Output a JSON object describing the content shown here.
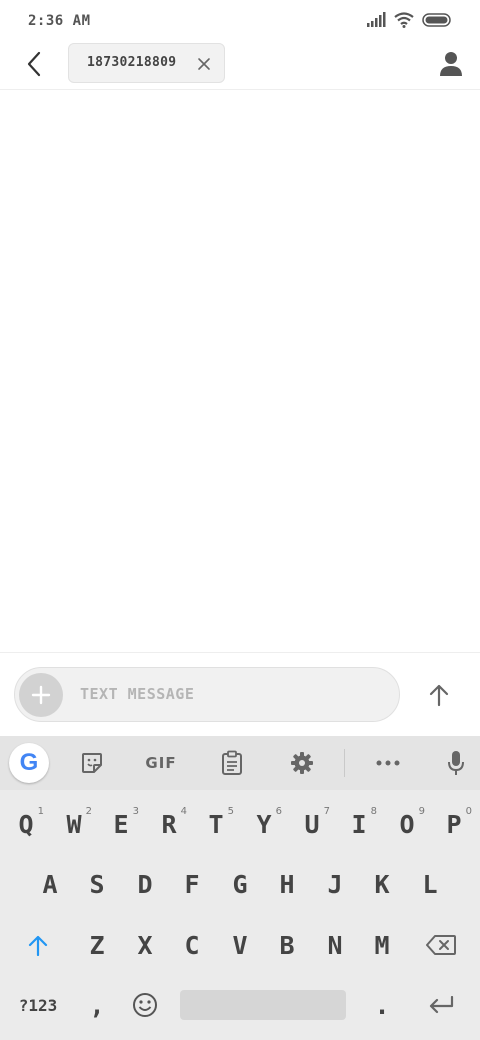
{
  "status_bar": {
    "time": "2:36 AM"
  },
  "header": {
    "recipient": "18730218809"
  },
  "compose": {
    "placeholder": "TEXT MESSAGE"
  },
  "keyboard": {
    "toolbar": {
      "google": "G",
      "gif": "GIF"
    },
    "row1": [
      {
        "k": "Q",
        "h": "1"
      },
      {
        "k": "W",
        "h": "2"
      },
      {
        "k": "E",
        "h": "3"
      },
      {
        "k": "R",
        "h": "4"
      },
      {
        "k": "T",
        "h": "5"
      },
      {
        "k": "Y",
        "h": "6"
      },
      {
        "k": "U",
        "h": "7"
      },
      {
        "k": "I",
        "h": "8"
      },
      {
        "k": "O",
        "h": "9"
      },
      {
        "k": "P",
        "h": "0"
      }
    ],
    "row2": [
      "A",
      "S",
      "D",
      "F",
      "G",
      "H",
      "J",
      "K",
      "L"
    ],
    "row3": [
      "Z",
      "X",
      "C",
      "V",
      "B",
      "N",
      "M"
    ],
    "bottom": {
      "symbols": "?123",
      "comma": ",",
      "period": "."
    }
  }
}
